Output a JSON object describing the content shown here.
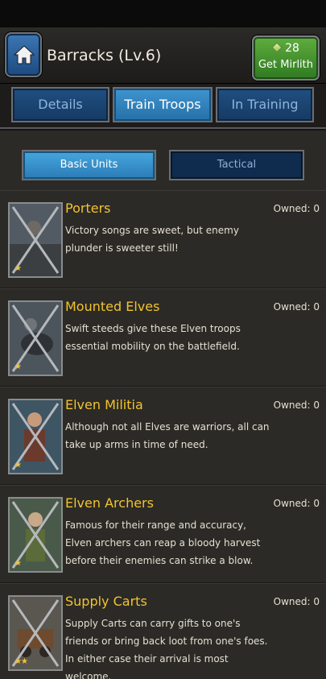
{
  "header": {
    "title": "Barracks (Lv.6)",
    "mirlith_count": "28",
    "mirlith_label": "Get Mirlith",
    "home_icon": "home-icon"
  },
  "tabs": [
    {
      "label": "Details",
      "active": false
    },
    {
      "label": "Train Troops",
      "active": true
    },
    {
      "label": "In Training",
      "active": false
    }
  ],
  "subtabs": [
    {
      "label": "Basic Units",
      "active": true
    },
    {
      "label": "Tactical",
      "active": false
    }
  ],
  "units": [
    {
      "name": "Porters",
      "owned": "Owned: 0",
      "stars": "★",
      "description": "Victory songs are sweet, but enemy plunder is sweeter still!"
    },
    {
      "name": "Mounted Elves",
      "owned": "Owned: 0",
      "stars": "★",
      "description": "Swift steeds give these Elven troops essential mobility on the battlefield."
    },
    {
      "name": "Elven Militia",
      "owned": "Owned: 0",
      "stars": "★",
      "description": "Although not all Elves are warriors, all can take up arms in time of need."
    },
    {
      "name": "Elven Archers",
      "owned": "Owned: 0",
      "stars": "★",
      "description": "Famous for their range and accuracy, Elven archers can reap a bloody harvest before their enemies can strike a blow."
    },
    {
      "name": "Supply Carts",
      "owned": "Owned: 0",
      "stars": "★★",
      "description": "Supply Carts can carry gifts to one's friends or bring back loot from one's foes. In either case their arrival is most welcome."
    }
  ],
  "colors": {
    "accent_gold": "#f3c32e",
    "tab_active": "#3f95d0",
    "button_green": "#5fae3e"
  }
}
